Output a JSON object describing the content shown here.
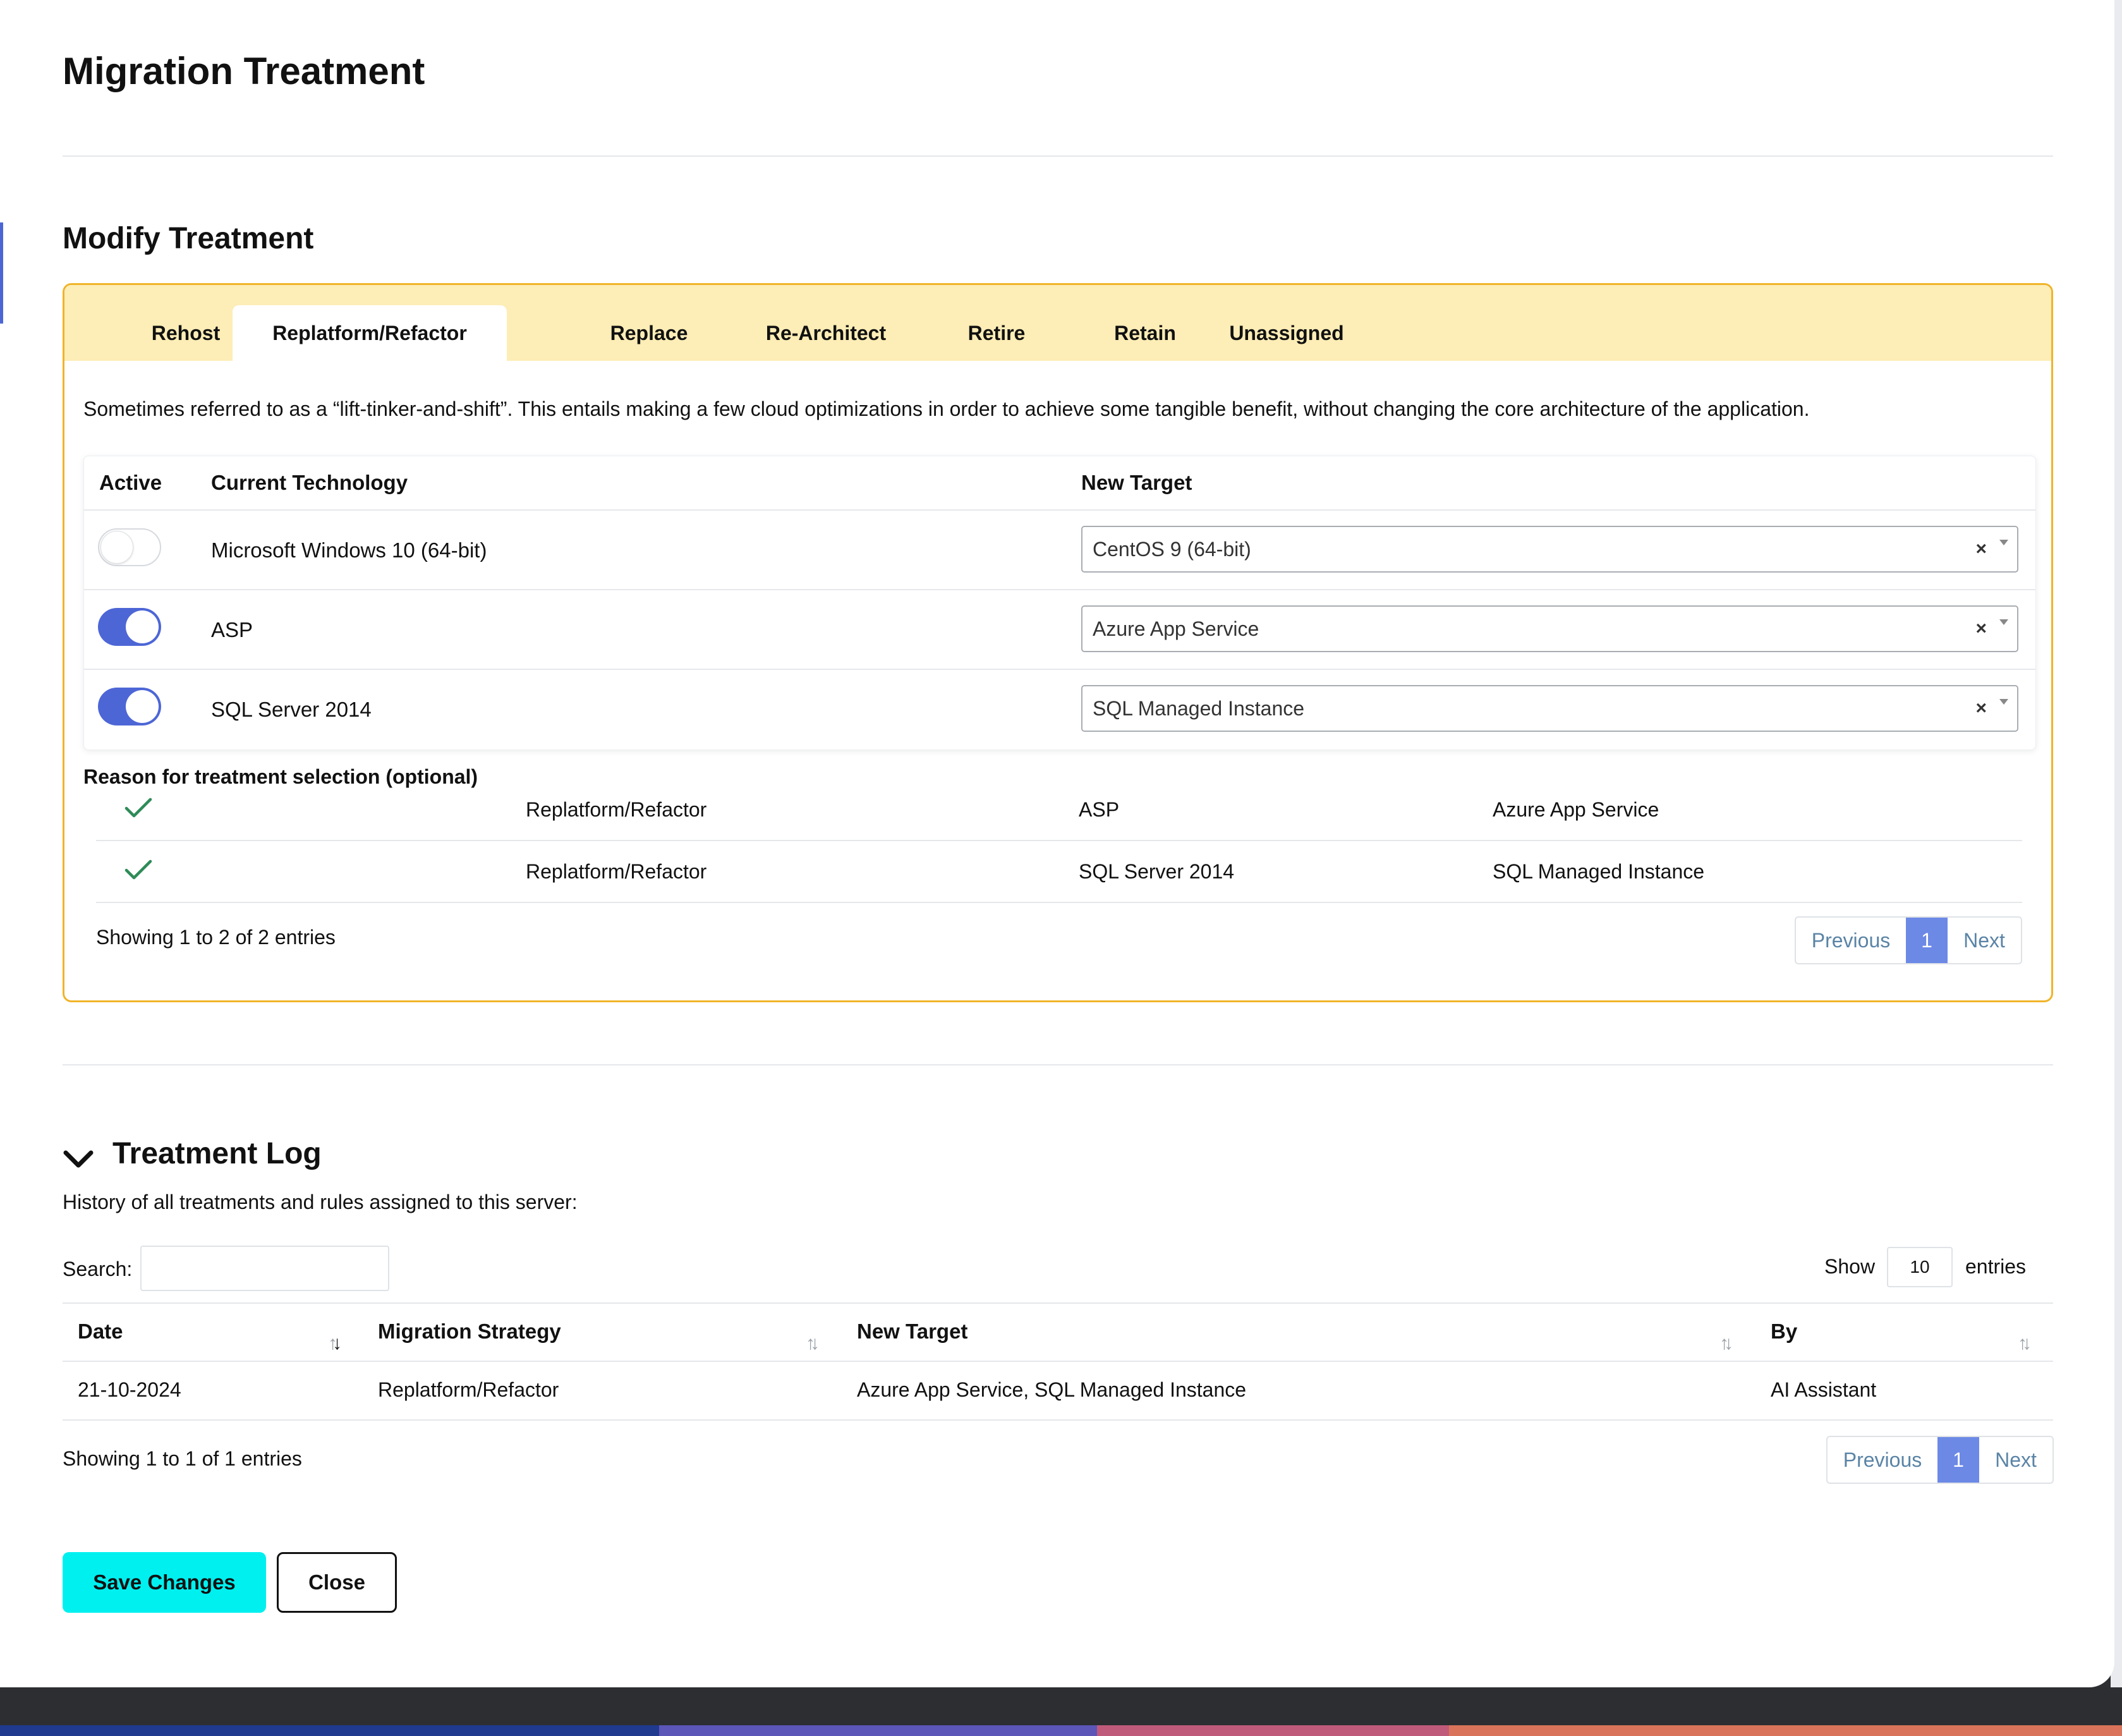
{
  "modal": {
    "title": "Migration Treatment",
    "section_title": "Modify Treatment"
  },
  "tabs": [
    {
      "label": "Rehost",
      "active": false
    },
    {
      "label": "Replatform/Refactor",
      "active": true
    },
    {
      "label": "Replace",
      "active": false
    },
    {
      "label": "Re-Architect",
      "active": false
    },
    {
      "label": "Retire",
      "active": false
    },
    {
      "label": "Retain",
      "active": false
    },
    {
      "label": "Unassigned",
      "active": false
    }
  ],
  "description": "Sometimes referred to as a “lift-tinker-and-shift”. This entails making a few cloud optimizations in order to achieve some tangible benefit, without changing the core architecture of the application.",
  "tech_table": {
    "headers": {
      "active": "Active",
      "current": "Current Technology",
      "target": "New Target"
    },
    "rows": [
      {
        "active": false,
        "technology": "Microsoft Windows 10 (64-bit)",
        "target": "CentOS 9 (64-bit)",
        "clear": "×"
      },
      {
        "active": true,
        "technology": "ASP",
        "target": "Azure App Service",
        "clear": "×"
      },
      {
        "active": true,
        "technology": "SQL Server 2014",
        "target": "SQL Managed Instance",
        "clear": "×"
      }
    ]
  },
  "reason_label": "Reason for treatment selection (optional)",
  "rules_table": {
    "rows": [
      {
        "strategy": "Replatform/Refactor",
        "technology": "ASP",
        "target": "Azure App Service"
      },
      {
        "strategy": "Replatform/Refactor",
        "technology": "SQL Server 2014",
        "target": "SQL Managed Instance"
      }
    ],
    "info": "Showing 1 to 2 of 2 entries",
    "pager": {
      "previous": "Previous",
      "page": "1",
      "next": "Next"
    }
  },
  "treatment_log": {
    "title": "Treatment Log",
    "subtitle": "History of all treatments and rules assigned to this server:",
    "search_label": "Search:",
    "search_value": "",
    "show_label": "Show",
    "entries_value": "10",
    "entries_label": "entries",
    "headers": {
      "date": "Date",
      "strategy": "Migration Strategy",
      "target": "New Target",
      "by": "By"
    },
    "rows": [
      {
        "date": "21-10-2024",
        "strategy": "Replatform/Refactor",
        "target": "Azure App Service, SQL Managed Instance",
        "by": "AI Assistant"
      }
    ],
    "info": "Showing 1 to 1 of 1 entries",
    "pager": {
      "previous": "Previous",
      "page": "1",
      "next": "Next"
    }
  },
  "actions": {
    "save": "Save Changes",
    "close": "Close"
  },
  "colors": {
    "accent": "#4d66d6",
    "tab_bar": "#fdedb6",
    "panel_border": "#f0b429",
    "save_button": "#00f0f0",
    "check": "#2e8b57"
  }
}
